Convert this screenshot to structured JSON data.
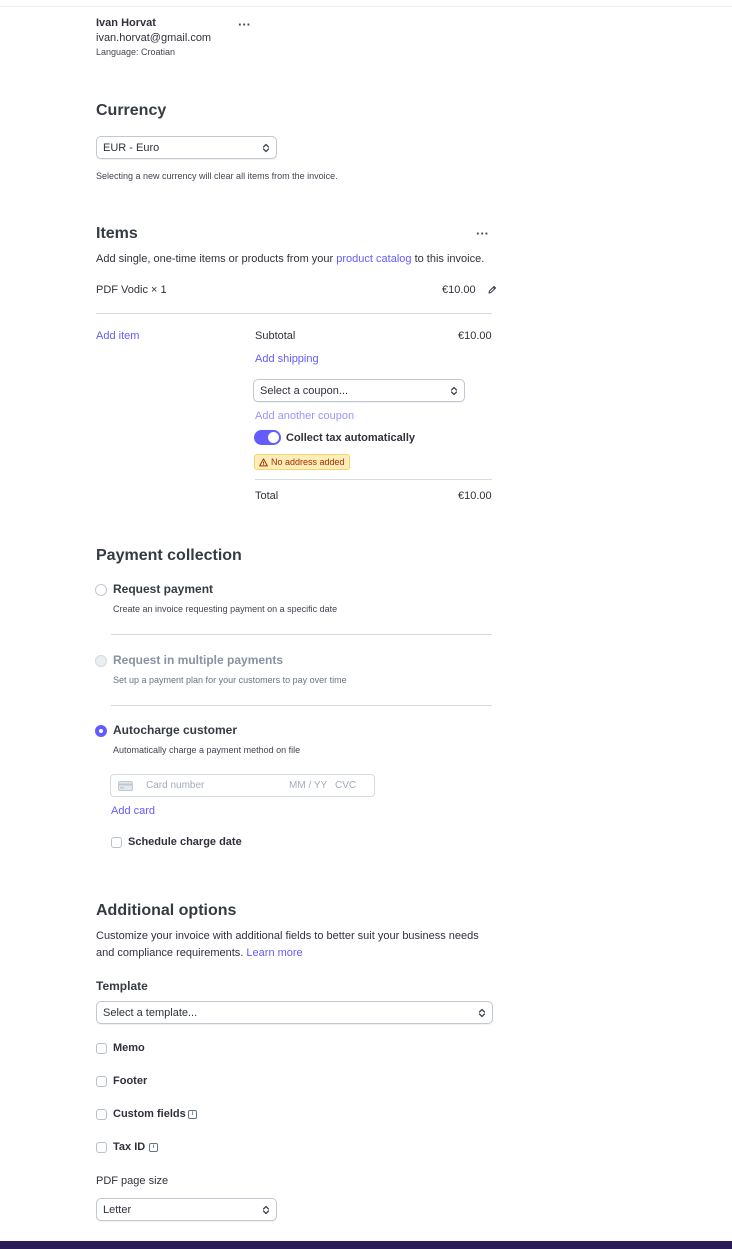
{
  "customer": {
    "name": "Ivan Horvat",
    "email": "ivan.horvat@gmail.com",
    "language": "Language: Croatian",
    "menu_label": "···"
  },
  "currency": {
    "heading": "Currency",
    "selected": "EUR - Euro",
    "hint": "Selecting a new currency will clear all items from the invoice."
  },
  "items": {
    "heading": "Items",
    "menu_label": "···",
    "description_prefix": "Add single, one-time items or products from your",
    "description_link": "product catalog",
    "description_suffix": "to this invoice.",
    "line_items": [
      {
        "name": "PDF Vodic × 1",
        "amount": "€10.00"
      }
    ],
    "add_item_label": "Add item",
    "subtotal_label": "Subtotal",
    "subtotal_value": "€10.00",
    "add_shipping_label": "Add shipping",
    "coupon_placeholder": "Select a coupon...",
    "add_another_coupon_label": "Add another coupon",
    "collect_tax_label": "Collect tax automatically",
    "collect_tax_enabled": true,
    "no_address_badge": "No address added",
    "total_label": "Total",
    "total_value": "€10.00"
  },
  "payment": {
    "heading": "Payment collection",
    "options": [
      {
        "title": "Request payment",
        "description": "Create an invoice requesting payment on a specific date",
        "state": "unselected"
      },
      {
        "title": "Request in multiple payments",
        "description": "Set up a payment plan for your customers to pay over time",
        "state": "disabled"
      },
      {
        "title": "Autocharge customer",
        "description": "Automatically charge a payment method on file",
        "state": "selected"
      }
    ],
    "card_number_placeholder": "Card number",
    "expiry_placeholder": "MM / YY",
    "cvc_placeholder": "CVC",
    "add_card_label": "Add card",
    "schedule_charge_label": "Schedule charge date"
  },
  "additional": {
    "heading": "Additional options",
    "description_line1": "Customize your invoice with additional fields to better suit your business needs",
    "description_line2": "and compliance requirements.",
    "learn_more_label": "Learn more",
    "template_label": "Template",
    "template_placeholder": "Select a template...",
    "checkboxes": [
      "Memo",
      "Footer",
      "Custom fields",
      "Tax ID"
    ],
    "page_size_label": "PDF page size",
    "page_size_selected": "Letter"
  },
  "colors": {
    "accent": "#635bff",
    "warning_bg": "#fcedb9",
    "footer_bar": "#2b1b57"
  }
}
